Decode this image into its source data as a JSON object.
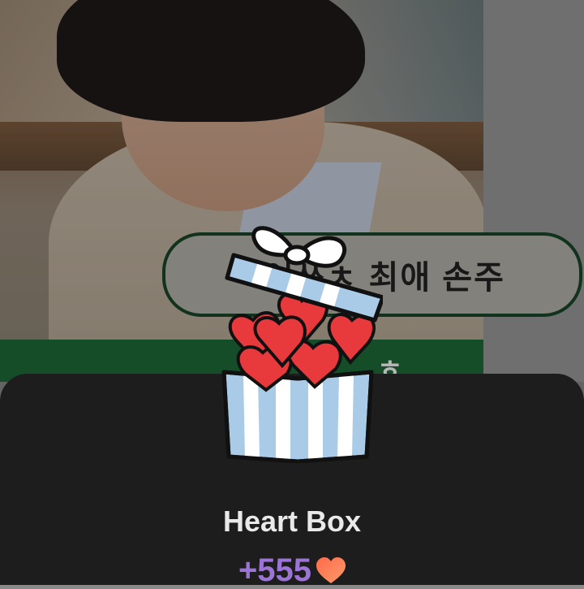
{
  "background": {
    "bubble_text": "어쓰ㅊ 최애 손주",
    "green_bar_text": "ㅎ"
  },
  "sheet": {
    "title": "Heart Box",
    "reward_amount": "+555",
    "reward_icon": "heart-icon"
  },
  "gift": {
    "icon": "gift-box-icon",
    "contents": "hearts"
  },
  "colors": {
    "sheet_bg": "#1d1d1d",
    "title": "#e9e9e9",
    "reward": "#9b74d6",
    "heart": "#e8393c",
    "box_blue": "#a9cbe8",
    "bubble_border": "#1f5a34"
  }
}
